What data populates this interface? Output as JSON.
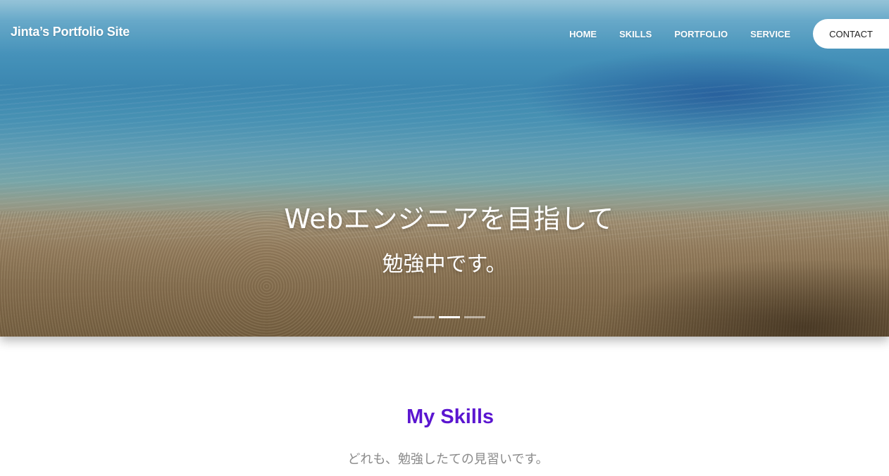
{
  "header": {
    "site_title": "Jinta’s Portfolio Site",
    "nav": [
      {
        "label": "HOME"
      },
      {
        "label": "SKILLS"
      },
      {
        "label": "PORTFOLIO"
      },
      {
        "label": "SERVICE"
      }
    ],
    "contact_label": "CONTACT"
  },
  "hero": {
    "title": "Webエンジニアを目指して",
    "subtitle": "勉強中です。",
    "slider": {
      "count": 3,
      "active_index": 1
    }
  },
  "skills": {
    "title": "My Skills",
    "subtitle": "どれも、勉強したての見習いです。"
  },
  "colors": {
    "accent": "#5b16d0",
    "nav_text": "#ffffff",
    "subtitle_gray": "#8a8a8a"
  }
}
